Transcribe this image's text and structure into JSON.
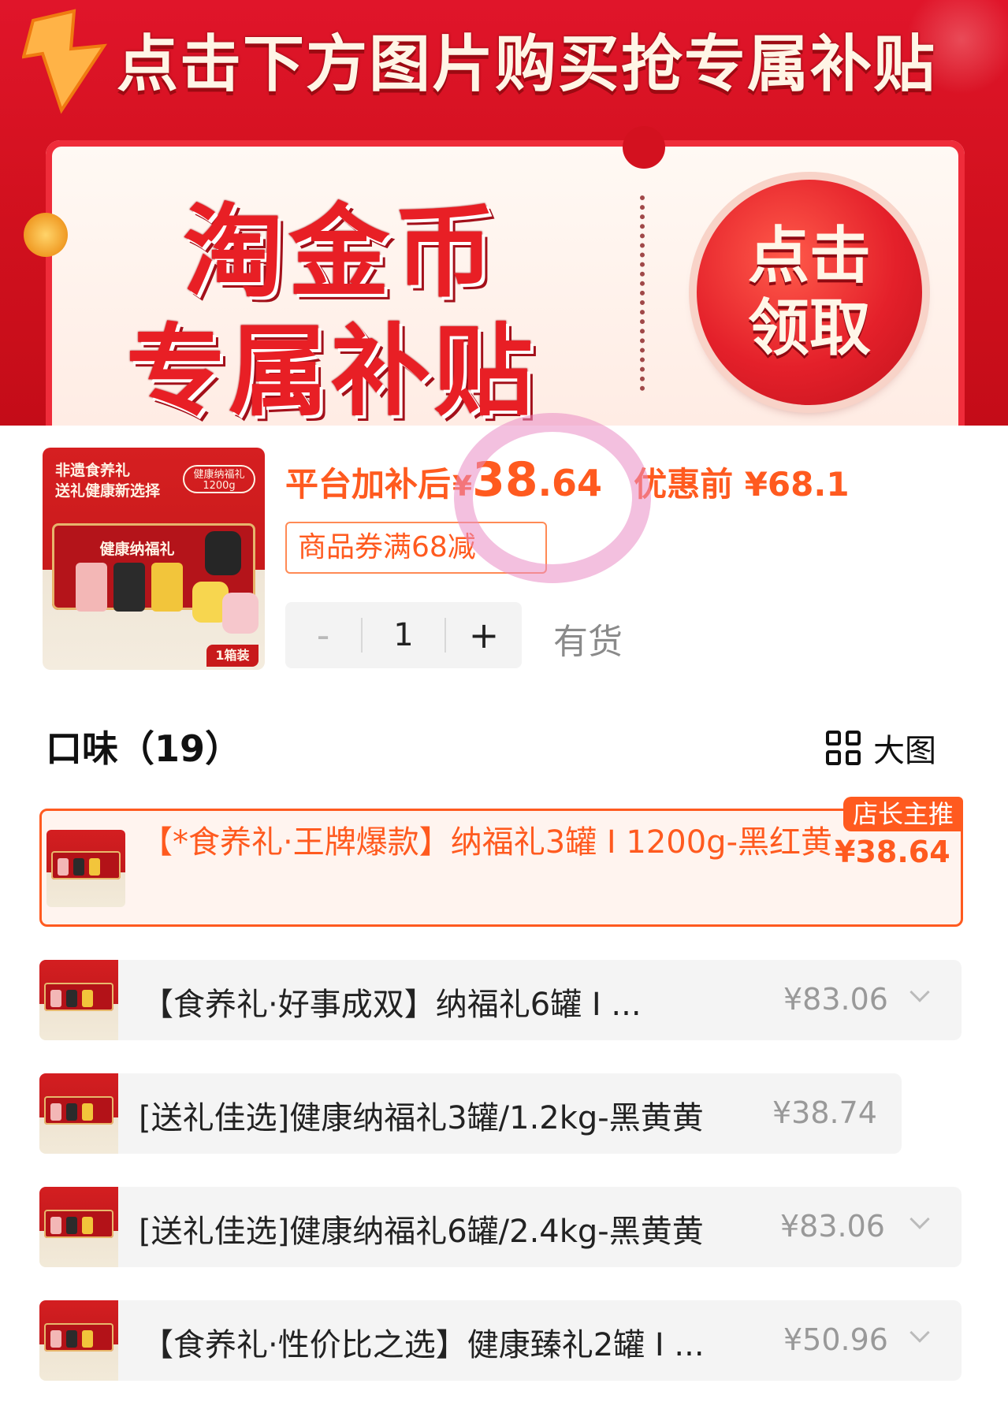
{
  "banner": {
    "headline": "点击下方图片购买抢专属补贴",
    "big_line_1": "淘金币",
    "big_line_2": "专属补贴",
    "claim_line_1": "点击",
    "claim_line_2": "领取"
  },
  "product": {
    "thumb": {
      "line_1": "非遗食养礼",
      "line_2": "送礼健康新选择",
      "tag": "健康纳福礼",
      "tag_sub": "1200g",
      "box_title": "健康纳福礼",
      "qty": "1箱装"
    },
    "price_label": "平台加补后",
    "currency": "¥",
    "price_int": "38",
    "price_dec": ".64",
    "original_price": "优惠前 ¥68.1",
    "coupon": "商品券满68减",
    "quantity": {
      "minus": "-",
      "value": "1",
      "plus": "+"
    },
    "stock": "有货",
    "accent_color": "#ff5a1f"
  },
  "flavor": {
    "title": "口味（19）",
    "view_toggle": "大图",
    "view_icon": "grid-icon"
  },
  "options": [
    {
      "name": "【*食养礼·王牌爆款】纳福礼3罐 I 1200g-黑红黄",
      "price": "¥38.64",
      "badge": "店长主推",
      "selected": true
    },
    {
      "name": "【食养礼·好事成双】纳福礼6罐 I ...",
      "price": "¥83.06",
      "selected": false
    },
    {
      "name": "[送礼佳选]健康纳福礼3罐/1.2kg-黑黄黄",
      "price": "¥38.74",
      "selected": false
    },
    {
      "name": "[送礼佳选]健康纳福礼6罐/2.4kg-黑黄黄",
      "price": "¥83.06",
      "selected": false
    },
    {
      "name": "【食养礼·性价比之选】健康臻礼2罐 I ...",
      "price": "¥50.96",
      "selected": false
    }
  ]
}
